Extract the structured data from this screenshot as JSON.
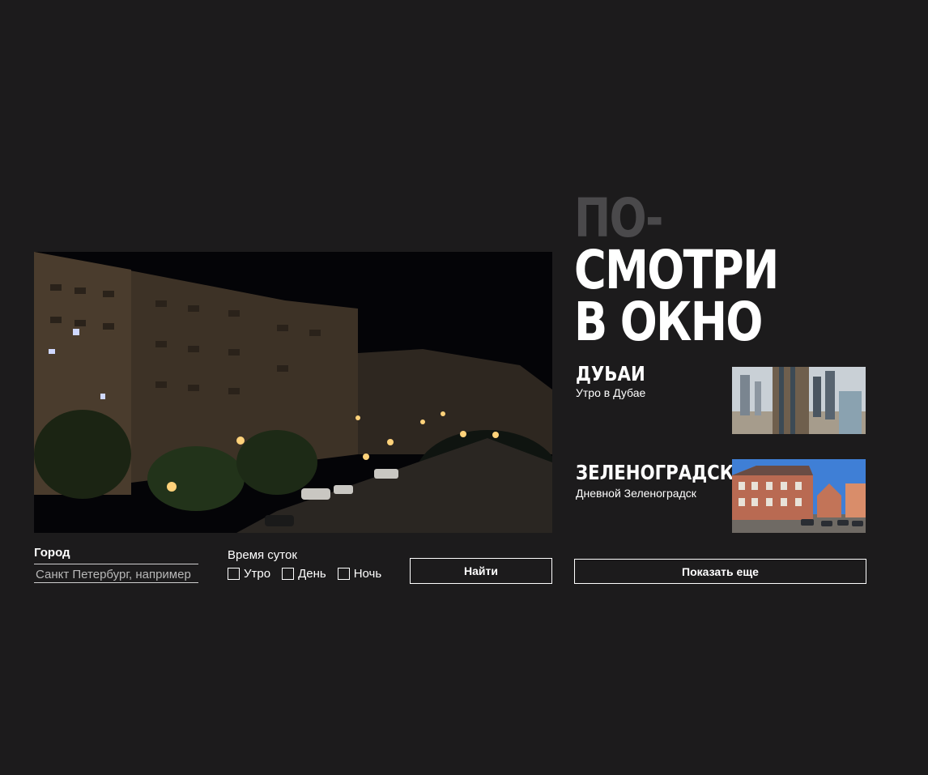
{
  "title": {
    "line1": "ПО-",
    "line2": "СМОТРИ",
    "line3": "В ОКНО"
  },
  "cards": [
    {
      "title": "ДУЬАИ",
      "subtitle": "Утро в Дубае"
    },
    {
      "title": "ЗЕЛЕНОГРАДСК",
      "subtitle": "Дневной Зеленоградск"
    }
  ],
  "form": {
    "city_label": "Город",
    "city_placeholder": "Санкт Петербург, например",
    "time_label": "Время суток",
    "options": [
      "Утро",
      "День",
      "Ночь"
    ],
    "search_button": "Найти",
    "more_button": "Показать еще"
  },
  "colors": {
    "background": "#1c1b1c",
    "title_muted": "#4a494b",
    "text": "#ffffff"
  }
}
